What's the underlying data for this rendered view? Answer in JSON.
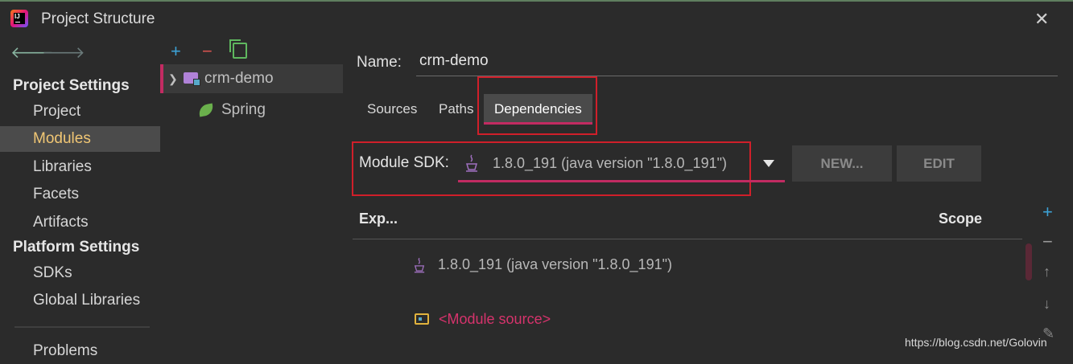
{
  "window": {
    "title": "Project Structure"
  },
  "sidebar": {
    "project_settings_header": "Project Settings",
    "project_items": [
      {
        "label": "Project"
      },
      {
        "label": "Modules"
      },
      {
        "label": "Libraries"
      },
      {
        "label": "Facets"
      },
      {
        "label": "Artifacts"
      }
    ],
    "platform_settings_header": "Platform Settings",
    "platform_items": [
      {
        "label": "SDKs"
      },
      {
        "label": "Global Libraries"
      }
    ],
    "problems_label": "Problems",
    "selected": "Modules"
  },
  "tree": {
    "module": "crm-demo",
    "child": "Spring"
  },
  "main": {
    "name_label": "Name:",
    "name_value": "crm-demo",
    "tabs": [
      {
        "label": "Sources"
      },
      {
        "label": "Paths"
      },
      {
        "label": "Dependencies"
      }
    ],
    "active_tab": "Dependencies",
    "sdk_label": "Module SDK:",
    "sdk_value": "1.8.0_191 (java version \"1.8.0_191\")",
    "new_button": "NEW...",
    "edit_button": "EDIT",
    "columns": {
      "export": "Exp...",
      "scope": "Scope"
    },
    "dependencies": [
      {
        "label": "1.8.0_191 (java version \"1.8.0_191\")"
      },
      {
        "label": "<Module source>"
      }
    ]
  },
  "watermark": "https://blog.csdn.net/Golovin",
  "colors": {
    "accent": "#c22b62",
    "highlight_box": "#d01f2a",
    "selected_text": "#f0c674"
  }
}
